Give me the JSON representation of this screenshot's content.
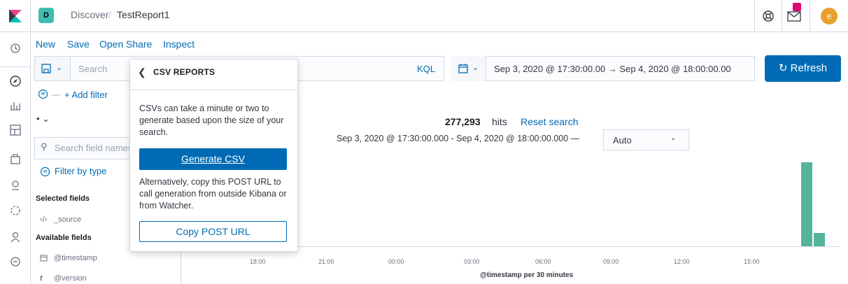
{
  "header": {
    "space_initial": "D",
    "breadcrumb_parent": "Discover",
    "breadcrumb_sep": "/",
    "breadcrumb_current": "TestReport1",
    "avatar_initial": "e"
  },
  "menu": [
    "New",
    "Save",
    "Open",
    "Share",
    "Inspect"
  ],
  "query": {
    "placeholder": "Search",
    "language": "KQL",
    "date_range": "Sep 3, 2020 @ 17:30:00.00  →  Sep 4, 2020 @ 18:00:00.00",
    "refresh_label": "Refresh",
    "add_filter": "+ Add filter"
  },
  "sidebar": {
    "search_placeholder": "Search field names",
    "filter_by_type": "Filter by type",
    "selected_heading": "Selected fields",
    "selected_fields": [
      "_source"
    ],
    "available_heading": "Available fields",
    "available_fields": [
      "@timestamp",
      "@version"
    ]
  },
  "results": {
    "hits_count": "277,293",
    "hits_label": "hits",
    "reset_search": "Reset search",
    "range_text": "Sep 3, 2020 @ 17:30:00.000 - Sep 4, 2020 @ 18:00:00.000 —",
    "interval": "Auto"
  },
  "chart_data": {
    "type": "bar",
    "x": [
      "18:00",
      "21:00",
      "00:00",
      "03:00",
      "06:00",
      "09:00",
      "12:00",
      "15:00"
    ],
    "xlabel": "@timestamp per 30 minutes",
    "bars_fraction_of_height": [
      0.95,
      0.15
    ]
  },
  "popover": {
    "title": "CSV REPORTS",
    "description": "CSVs can take a minute or two to generate based upon the size of your search.",
    "generate_label": "Generate CSV",
    "alt_text": "Alternatively, copy this POST URL to call generation from outside Kibana or from Watcher.",
    "copy_label": "Copy POST URL"
  },
  "colors": {
    "accent": "#006bb4",
    "bar": "#54b399",
    "brand_pink": "#dd0a73"
  }
}
